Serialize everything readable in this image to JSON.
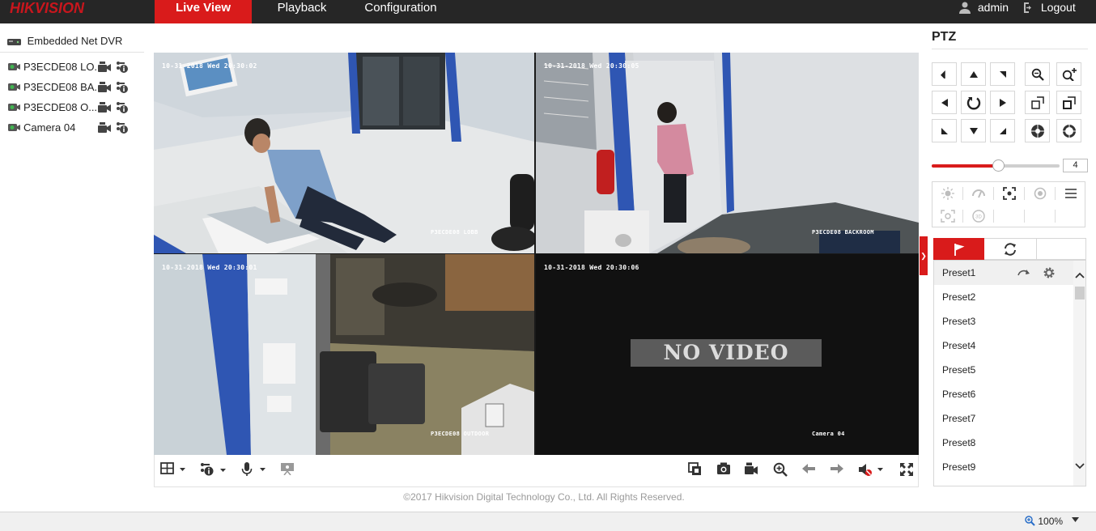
{
  "brand": {
    "logo": "HIKVISION",
    "accent_color": "#d91b1b"
  },
  "nav": {
    "tabs": [
      {
        "label": "Live View",
        "active": true
      },
      {
        "label": "Playback",
        "active": false
      },
      {
        "label": "Configuration",
        "active": false
      }
    ],
    "user": "admin",
    "logout": "Logout"
  },
  "device_tree": {
    "root": "Embedded Net DVR",
    "cameras": [
      {
        "label": "P3ECDE08 LO...",
        "icon": "camera-recording-icon"
      },
      {
        "label": "P3ECDE08 BA...",
        "icon": "camera-recording-icon"
      },
      {
        "label": "P3ECDE08 O...",
        "icon": "camera-recording-icon"
      },
      {
        "label": "Camera 04",
        "icon": "camera-recording-icon"
      }
    ]
  },
  "video": {
    "panes": [
      {
        "time": "10-31-2018 Wed 20:30:02",
        "name": "P3ECDE08 LOBB",
        "selected": true
      },
      {
        "time": "10-31-2018 Wed 20:30:05",
        "name": "P3ECDE08 BACKROOM",
        "selected": false
      },
      {
        "time": "10-31-2018 Wed 20:30:01",
        "name": "P3ECDE08 OUTDOOR",
        "selected": false
      },
      {
        "time": "10-31-2018 Wed 20:30:06",
        "name": "Camera 04",
        "no_video": "NO VIDEO",
        "selected": false
      }
    ]
  },
  "toolbar": {
    "left": [
      "window-layout-icon",
      "stream-info-icon",
      "microphone-icon",
      "tv-wall-icon"
    ],
    "right": [
      "multi-capture-icon",
      "capture-icon",
      "record-icon",
      "digital-zoom-icon",
      "prev-page-icon",
      "next-page-icon",
      "audio-muted-icon",
      "fullscreen-icon"
    ]
  },
  "footer": "©2017 Hikvision Digital Technology Co., Ltd. All Rights Reserved.",
  "ptz": {
    "title": "PTZ",
    "speed": "4",
    "speed_fraction": 0.52,
    "tabs": [
      "preset-flag-icon",
      "patrol-icon",
      "pattern-tab"
    ],
    "presets": [
      "Preset1",
      "Preset2",
      "Preset3",
      "Preset4",
      "Preset5",
      "Preset6",
      "Preset7",
      "Preset8",
      "Preset9"
    ]
  },
  "statusbar": {
    "zoom": "100%"
  }
}
